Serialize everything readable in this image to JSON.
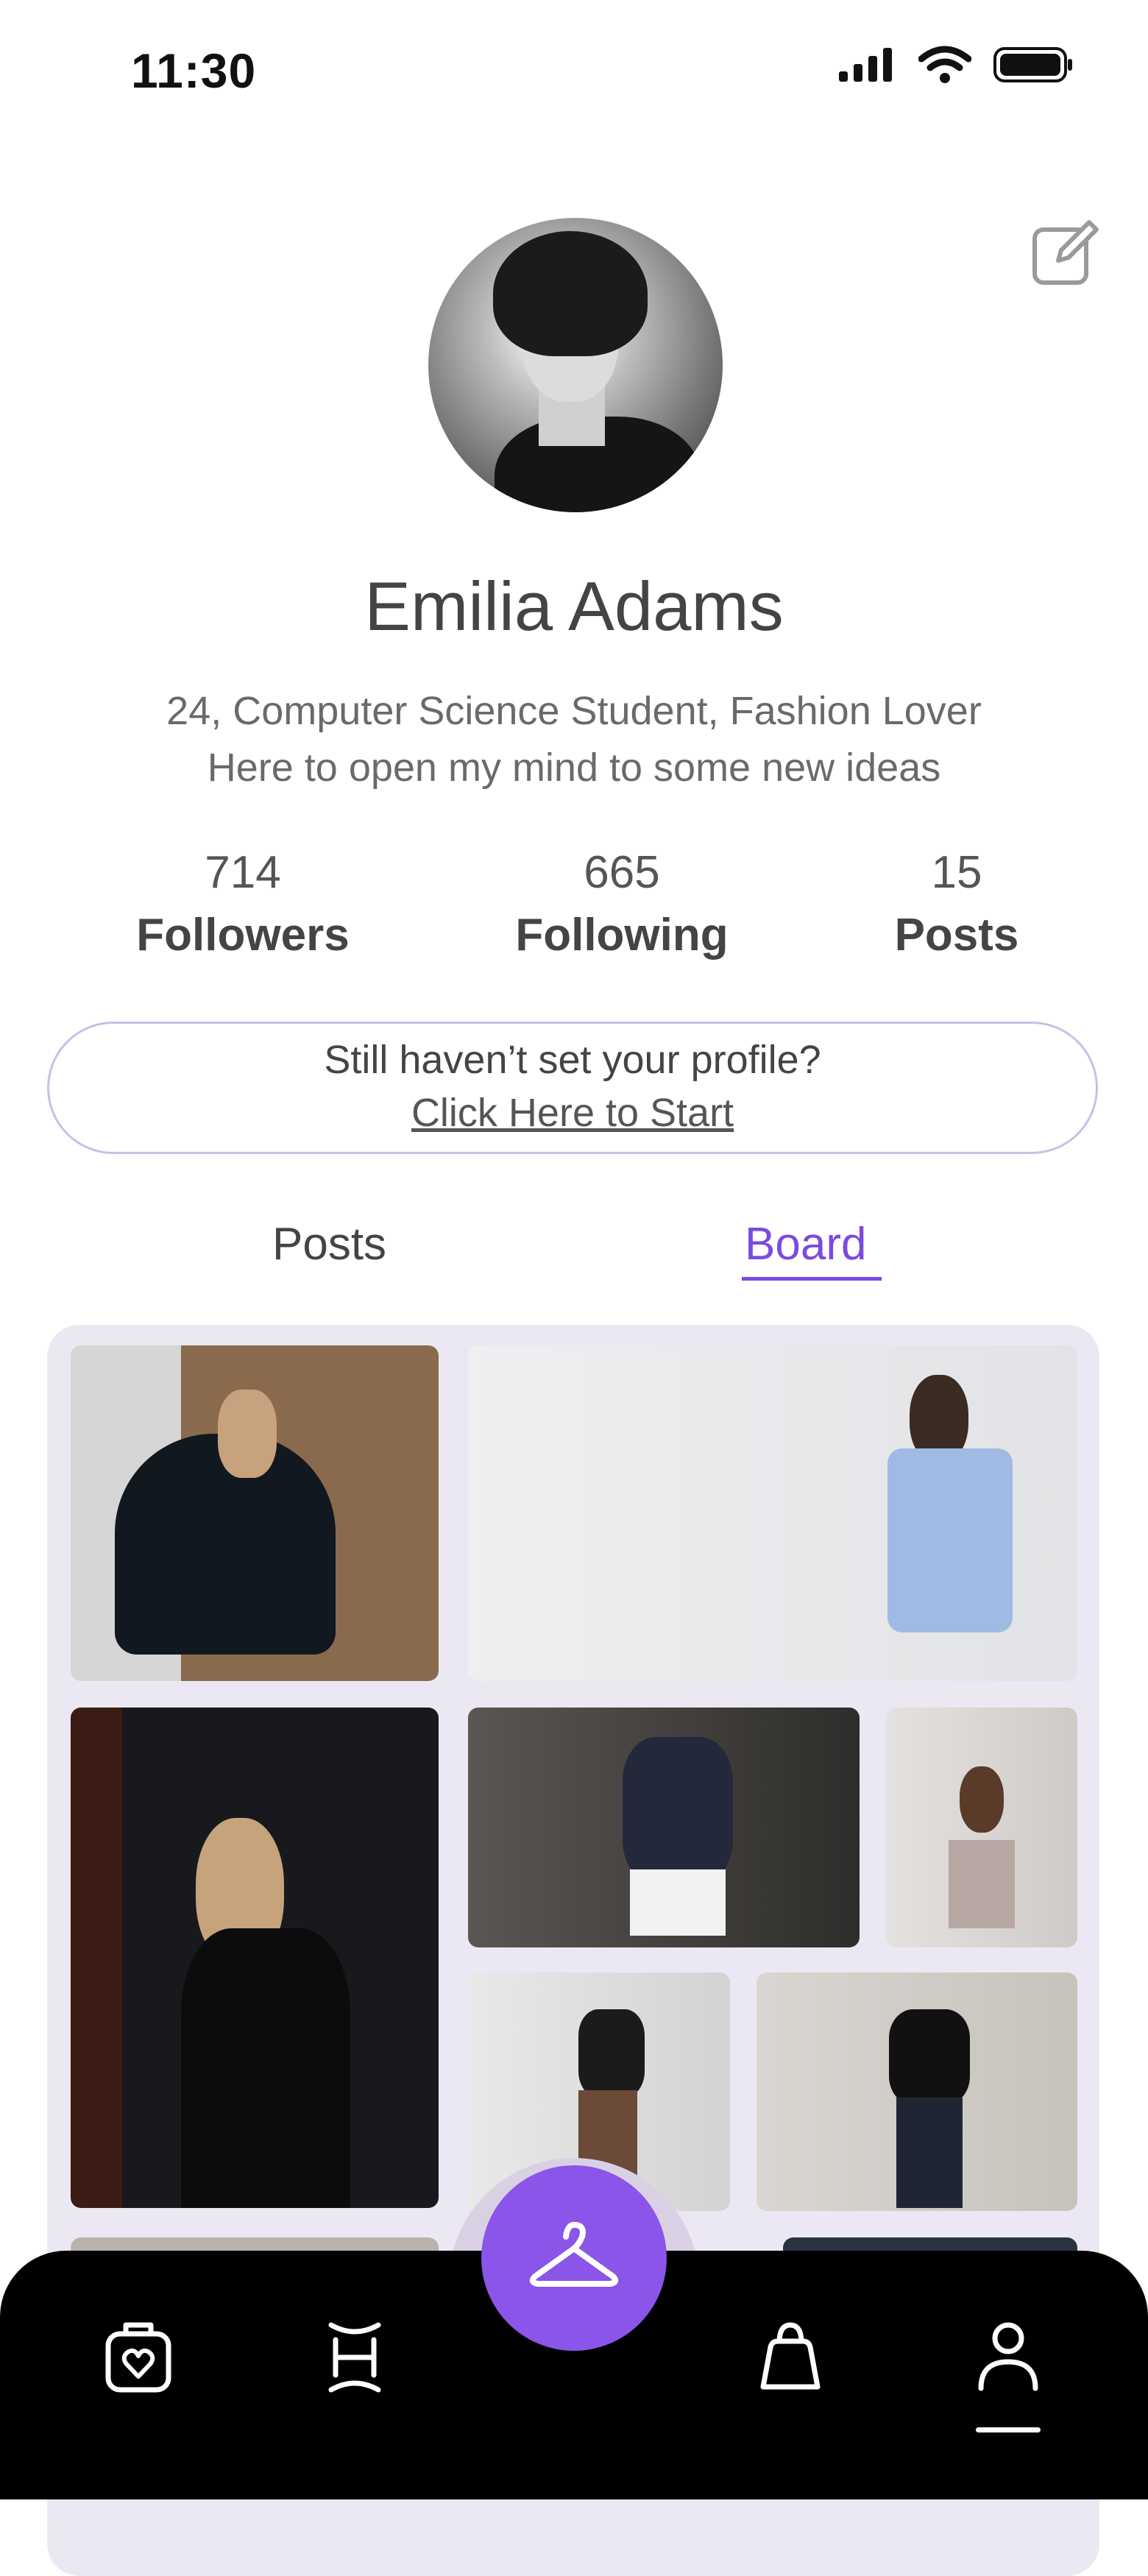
{
  "status_bar": {
    "time": "11:30"
  },
  "profile": {
    "name": "Emilia Adams",
    "bio_line1": "24, Computer Science Student, Fashion Lover",
    "bio_line2": "Here to open my mind to some new ideas",
    "stats": [
      {
        "value": "714",
        "label": "Followers"
      },
      {
        "value": "665",
        "label": "Following"
      },
      {
        "value": "15",
        "label": "Posts"
      }
    ]
  },
  "setup_prompt": {
    "line1": "Still haven’t set your profile?",
    "link": "Click Here to Start"
  },
  "tabs": [
    {
      "label": "Posts",
      "active": false
    },
    {
      "label": "Board",
      "active": true
    }
  ],
  "colors": {
    "accent": "#7a4be0",
    "fab": "#8a55e8",
    "board_bg": "#ece8f3"
  },
  "nav": {
    "items": [
      "wishlist-bag-heart-icon",
      "outfit-icon",
      "hanger-icon",
      "shopping-bag-icon",
      "profile-icon"
    ],
    "active": "profile-icon"
  }
}
